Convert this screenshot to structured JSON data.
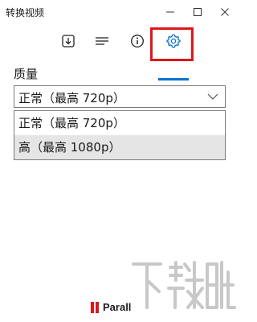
{
  "window": {
    "title": "转换视频"
  },
  "toolbar": {
    "tabs": [
      {
        "icon": "download-icon"
      },
      {
        "icon": "list-icon"
      },
      {
        "icon": "info-icon"
      },
      {
        "icon": "gear-icon",
        "selected": true
      }
    ],
    "accent_color": "#0a74d1",
    "highlight_color": "#e0161a"
  },
  "quality": {
    "label": "质量",
    "selected": "正常（最高 720p）",
    "options": [
      "正常（最高 720p）",
      "高（最高 1080p）"
    ]
  },
  "footer": {
    "brand": "Parall"
  },
  "watermark": {
    "text": "下载吧"
  }
}
